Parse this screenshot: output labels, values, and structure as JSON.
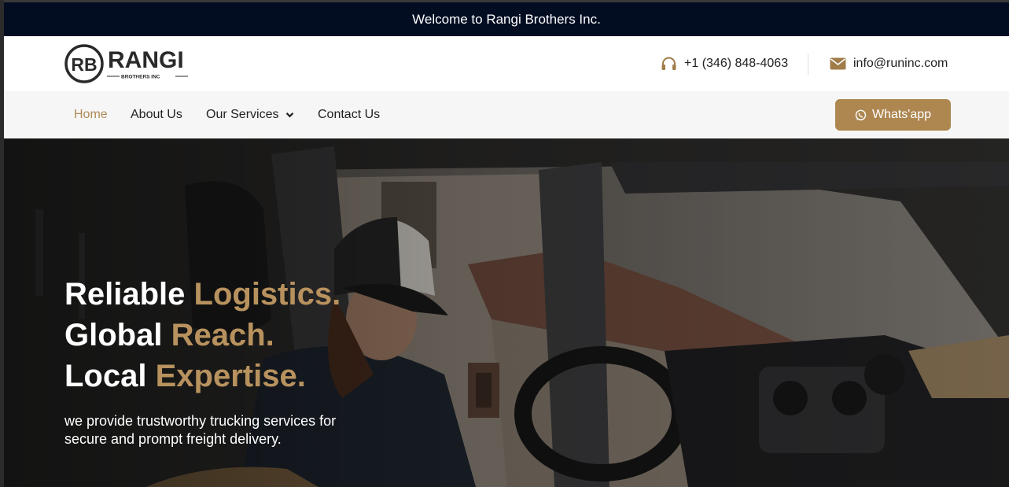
{
  "topbar": {
    "welcome_text": "Welcome to Rangi Brothers Inc."
  },
  "header": {
    "logo": {
      "monogram": "RB",
      "name": "RANGI",
      "tagline": "BROTHERS INC"
    },
    "phone": "+1 (346) 848-4063",
    "phone_icon": "headset-icon",
    "email": "info@runinc.com",
    "email_icon": "envelope-icon"
  },
  "nav": {
    "items": [
      {
        "label": "Home",
        "active": true
      },
      {
        "label": "About Us",
        "active": false
      },
      {
        "label": "Our Services",
        "active": false,
        "has_dropdown": true
      },
      {
        "label": "Contact Us",
        "active": false
      }
    ],
    "whatsapp_button": {
      "label": "Whats'app",
      "icon": "whatsapp-icon"
    }
  },
  "hero": {
    "lines": [
      {
        "plain": "Reliable ",
        "accent": "Logistics."
      },
      {
        "plain": "Global ",
        "accent": "Reach."
      },
      {
        "plain": "Local ",
        "accent": "Expertise."
      }
    ],
    "subtitle": "we provide trustworthy trucking services for secure and prompt freight delivery."
  },
  "colors": {
    "topbar_bg": "#020d22",
    "accent": "#b08a57",
    "button_bg": "#ad8650",
    "nav_bg": "#f6f6f6"
  }
}
